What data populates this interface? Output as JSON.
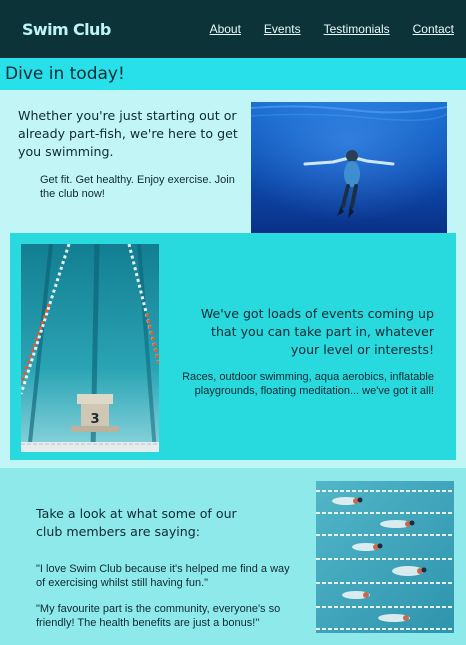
{
  "nav": {
    "brand": "Swim Club",
    "links": [
      "About",
      "Events",
      "Testimonials",
      "Contact"
    ]
  },
  "hero": {
    "title": "Dive in today!"
  },
  "intro": {
    "heading": "Whether you're just starting out or already part-fish, we're here to get you swimming.",
    "body": "Get fit. Get healthy. Enjoy exercise. Join the club now!"
  },
  "events": {
    "heading": "We've got loads of events coming up that you can take part in, whatever your level or interests!",
    "body": "Races, outdoor swimming, aqua aerobics, inflatable playgrounds, floating meditation... we've got it all!"
  },
  "testimonials": {
    "heading": "Take a look at what some of our club members are saying:",
    "quotes": [
      "\"I love Swim Club because it's helped me find a way of exercising whilst still having fun.\"",
      "\"My favourite part is the community, everyone's so friendly! The health benefits are just a bonus!\""
    ]
  },
  "images": {
    "pool_block_number": "3"
  },
  "colors": {
    "navbar": "#0c3338",
    "title_bar": "#28e0ea",
    "light_section": "#c2f6f6",
    "events_panel": "#28d9de",
    "testimonials_bg": "#8eeaea"
  }
}
